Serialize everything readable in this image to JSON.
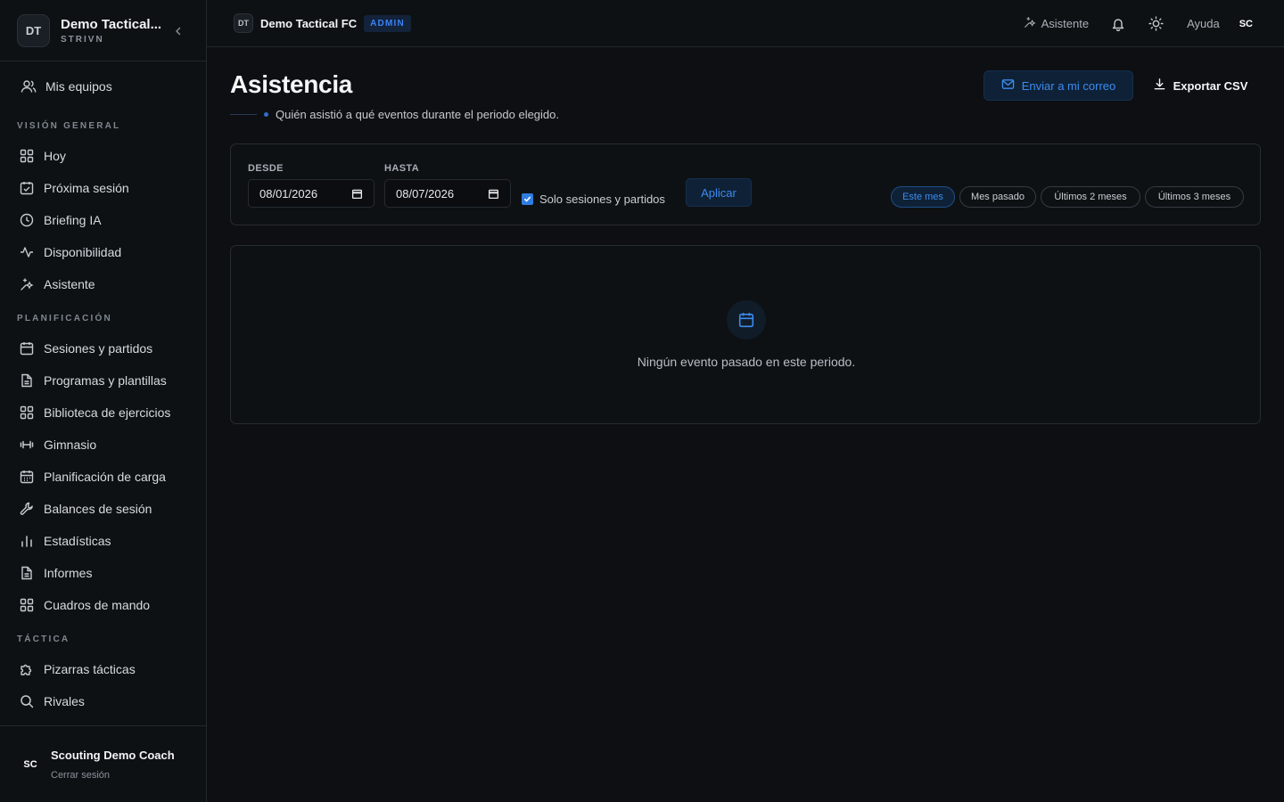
{
  "sidebar": {
    "org_initials": "DT",
    "org_name": "Demo Tactical...",
    "org_sub": "STRIVN",
    "collapse_icon": "chevron-left-icon",
    "my_teams": "Mis equipos",
    "sections": {
      "overview": "VISIÓN GENERAL",
      "planning": "PLANIFICACIÓN",
      "tactics": "TÁCTICA"
    },
    "items": {
      "today": "Hoy",
      "next_session": "Próxima sesión",
      "briefing": "Briefing IA",
      "availability": "Disponibilidad",
      "assistant": "Asistente",
      "sessions": "Sesiones y partidos",
      "programs": "Programas y plantillas",
      "library": "Biblioteca de ejercicios",
      "gym": "Gimnasio",
      "load": "Planificación de carga",
      "balances": "Balances de sesión",
      "stats": "Estadísticas",
      "reports": "Informes",
      "dashboards": "Cuadros de mando",
      "boards": "Pizarras tácticas",
      "rivals": "Rivales"
    },
    "user": {
      "initials": "SC",
      "name": "Scouting Demo Coach",
      "logout": "Cerrar sesión"
    }
  },
  "topbar": {
    "team_initials": "DT",
    "team_name": "Demo Tactical FC",
    "badge": "ADMIN",
    "assistant": "Asistente",
    "help": "Ayuda",
    "user_initials": "SC"
  },
  "main": {
    "title": "Asistencia",
    "subtitle": "Quién asistió a qué eventos durante el periodo elegido.",
    "send_mail": "Enviar a mi correo",
    "export_csv": "Exportar CSV",
    "filters": {
      "from_label": "DESDE",
      "from_value": "08/01/2026",
      "to_label": "HASTA",
      "to_value": "08/07/2026",
      "only_sessions_label": "Solo sesiones y partidos",
      "only_sessions_checked": true,
      "apply": "Aplicar",
      "chips": [
        "Este mes",
        "Mes pasado",
        "Últimos 2 meses",
        "Últimos 3 meses"
      ],
      "active_chip": "Este mes"
    },
    "empty_text": "Ningún evento pasado en este periodo."
  },
  "colors": {
    "accent": "#3b8cf0",
    "background": "#0d0f12",
    "panel": "#0e1114",
    "border": "#262c33"
  }
}
